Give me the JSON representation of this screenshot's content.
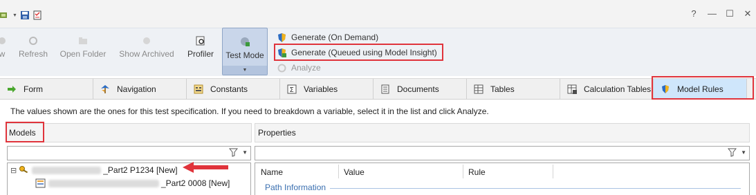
{
  "window": {
    "help": "?",
    "minimize": "—",
    "maximize": "☐",
    "close": "✕"
  },
  "ribbon": {
    "buttons": [
      {
        "label": "w",
        "icon": "view-icon"
      },
      {
        "label": "Refresh",
        "icon": "refresh-icon"
      },
      {
        "label": "Open Folder",
        "icon": "folder-icon"
      },
      {
        "label": "Show Archived",
        "icon": "archive-icon"
      },
      {
        "label": "Profiler",
        "icon": "profiler-icon"
      },
      {
        "label": "Test Mode",
        "icon": "test-mode-icon"
      }
    ],
    "generate": [
      {
        "label": "Generate (On Demand)",
        "icon": "shield-icon"
      },
      {
        "label": "Generate (Queued using Model Insight)",
        "icon": "shield-model-icon"
      },
      {
        "label": "Analyze",
        "icon": "analyze-icon"
      }
    ]
  },
  "tabs": [
    {
      "label": "Form",
      "icon": "arrow-right-icon"
    },
    {
      "label": "Navigation",
      "icon": "navigation-icon"
    },
    {
      "label": "Constants",
      "icon": "constants-icon"
    },
    {
      "label": "Variables",
      "icon": "sigma-icon"
    },
    {
      "label": "Documents",
      "icon": "document-icon"
    },
    {
      "label": "Tables",
      "icon": "table-icon"
    },
    {
      "label": "Calculation Tables",
      "icon": "calc-table-icon"
    },
    {
      "label": "Model Rules",
      "icon": "shield-icon",
      "active": true
    }
  ],
  "info_text": "The values shown are the ones for this test specification. If you need to breakdown a variable, select it in the list and click Analyze.",
  "models": {
    "title": "Models",
    "tree": [
      {
        "expander": "⊟",
        "label": "_Part2 P1234 [New]"
      },
      {
        "label": "_Part2 0008 [New]"
      }
    ]
  },
  "properties": {
    "title": "Properties",
    "columns": [
      "Name",
      "Value",
      "Rule"
    ],
    "group": "Path Information"
  },
  "colors": {
    "highlight": "#e0333b",
    "active_tab": "#cfe6fb",
    "test_mode": "#c9d6ea"
  }
}
